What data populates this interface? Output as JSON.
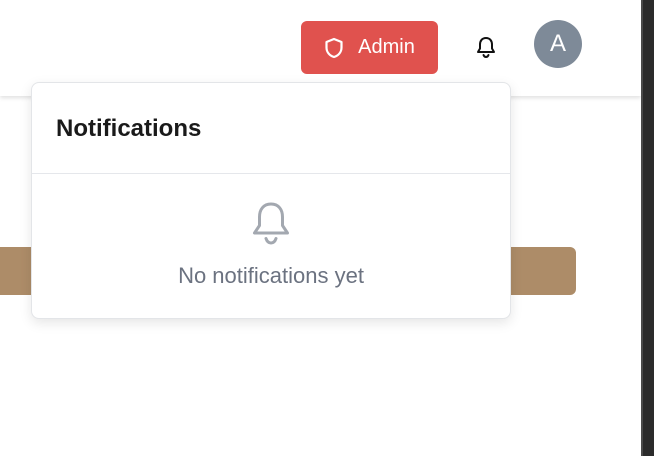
{
  "header": {
    "admin_button": {
      "label": "Admin",
      "icon": "shield-icon",
      "color": "#e0524e"
    },
    "notifications_button": {
      "icon": "bell-icon"
    },
    "avatar": {
      "initial": "A",
      "color": "#7e8a98"
    }
  },
  "notifications_dropdown": {
    "title": "Notifications",
    "empty_state": {
      "icon": "bell-icon",
      "message": "No notifications yet"
    }
  },
  "background": {
    "banner_color": "#ad8c68"
  }
}
